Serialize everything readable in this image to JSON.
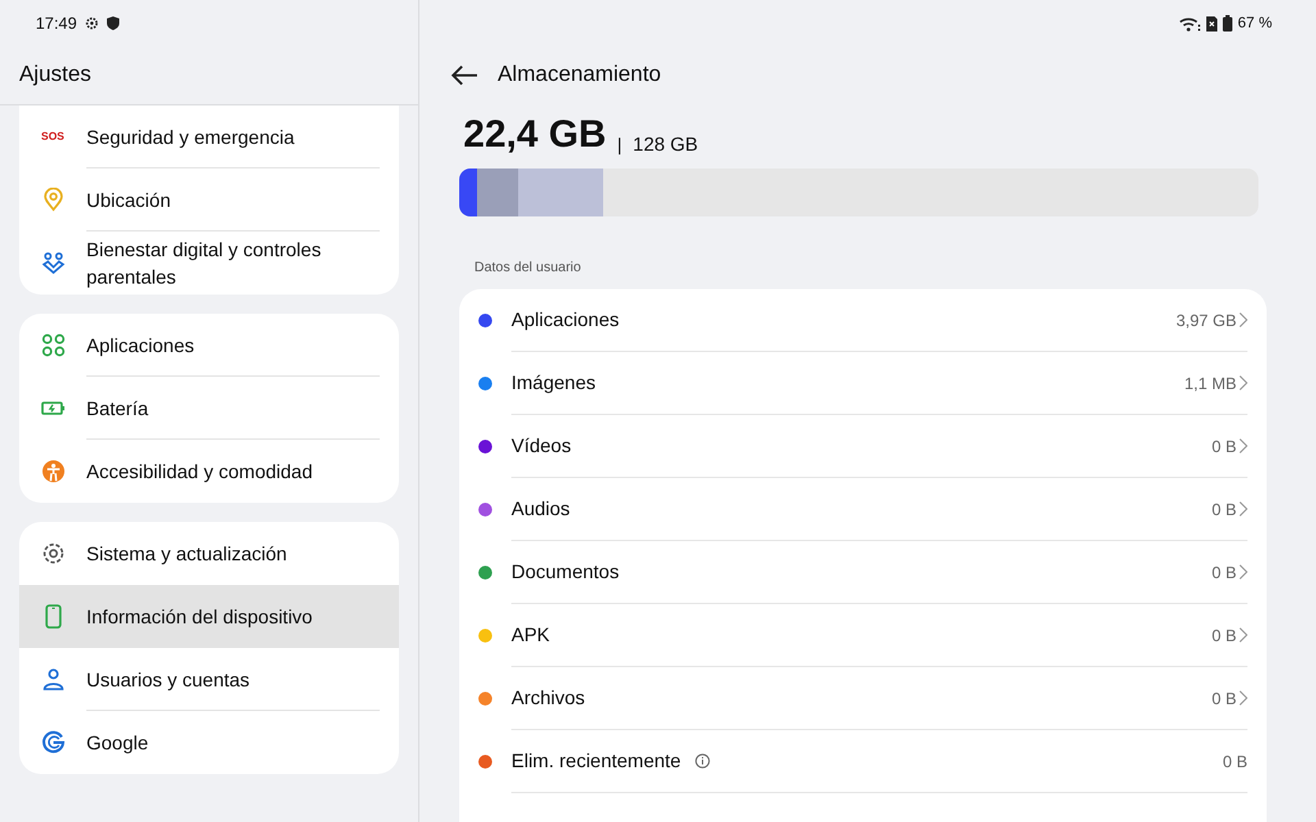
{
  "status_bar": {
    "time": "17:49",
    "battery": "67 %"
  },
  "sidebar": {
    "title": "Ajustes",
    "groups": [
      {
        "items": [
          {
            "label": "Seguridad y emergencia",
            "icon_text": "SOS",
            "selected": false
          },
          {
            "label": "Ubicación",
            "selected": false
          },
          {
            "label": "Bienestar digital y controles parentales",
            "selected": false
          }
        ]
      },
      {
        "items": [
          {
            "label": "Aplicaciones",
            "selected": false
          },
          {
            "label": "Batería",
            "selected": false
          },
          {
            "label": "Accesibilidad y comodidad",
            "selected": false
          }
        ]
      },
      {
        "items": [
          {
            "label": "Sistema y actualización",
            "selected": false
          },
          {
            "label": "Información del dispositivo",
            "selected": true
          },
          {
            "label": "Usuarios y cuentas",
            "selected": false
          },
          {
            "label": "Google",
            "selected": false
          }
        ]
      }
    ]
  },
  "header": {
    "title": "Almacenamiento"
  },
  "storage": {
    "used": "22,4 GB",
    "separator": "|",
    "total": "128 GB",
    "segments": [
      {
        "level": 0.023,
        "color": "#3848f5"
      },
      {
        "level": 0.05,
        "color": "#9a9fb8"
      },
      {
        "level": 0.107,
        "color": "#bcc0d8"
      }
    ]
  },
  "section_label": "Datos del usuario",
  "categories": [
    {
      "label": "Aplicaciones",
      "value": "3,97 GB",
      "color": "#3548f0",
      "kind": "link"
    },
    {
      "label": "Imágenes",
      "value": "1,1 MB",
      "color": "#1a7ff0",
      "kind": "link"
    },
    {
      "label": "Vídeos",
      "value": "0 B",
      "color": "#6a12d6",
      "kind": "link"
    },
    {
      "label": "Audios",
      "value": "0 B",
      "color": "#a050e0",
      "kind": "link"
    },
    {
      "label": "Documentos",
      "value": "0 B",
      "color": "#2ea050",
      "kind": "link"
    },
    {
      "label": "APK",
      "value": "0 B",
      "color": "#f8c010",
      "kind": "link"
    },
    {
      "label": "Archivos",
      "value": "0 B",
      "color": "#f5832a",
      "kind": "link"
    },
    {
      "label": "Elim. recientemente",
      "value": "0 B",
      "color": "#e85a20",
      "kind": "info"
    }
  ]
}
